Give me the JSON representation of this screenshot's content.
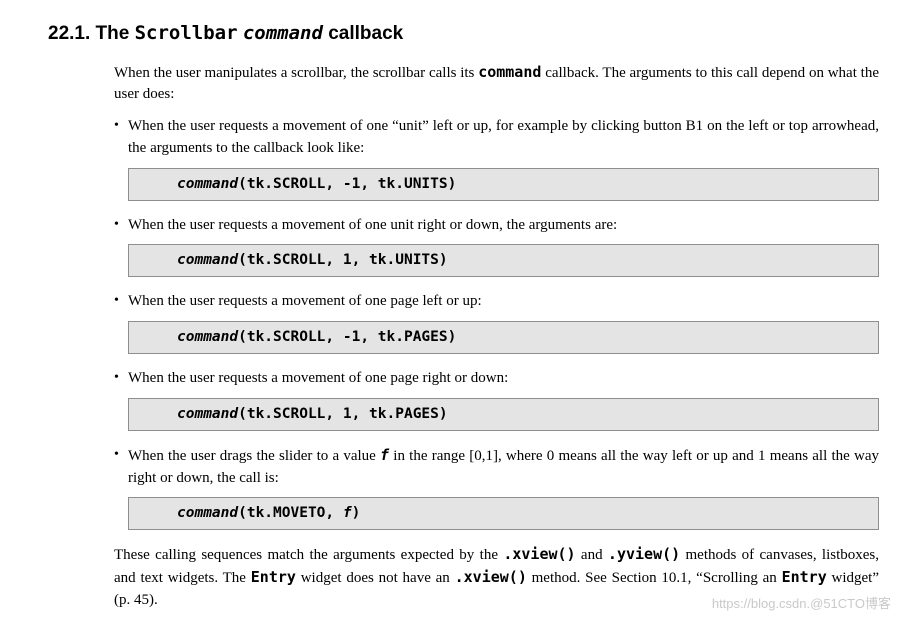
{
  "heading": {
    "number": "22.1.",
    "prefix": "The ",
    "code1": "Scrollbar",
    "space": " ",
    "code2": "command",
    "suffix": " callback"
  },
  "intro": {
    "t1": "When the user manipulates a scrollbar, the scrollbar calls its ",
    "c1": "command",
    "t2": " callback. The arguments to this call depend on what the user does:"
  },
  "items": [
    {
      "text": "When the user requests a movement of one “unit” left or up, for example by clicking button B1 on the left or top arrowhead, the arguments to the callback look like:",
      "code_i": "command",
      "code_r": "(tk.SCROLL, -1, tk.UNITS)"
    },
    {
      "text": "When the user requests a movement of one unit right or down, the arguments are:",
      "code_i": "command",
      "code_r": "(tk.SCROLL, 1, tk.UNITS)"
    },
    {
      "text": "When the user requests a movement of one page left or up:",
      "code_i": "command",
      "code_r": "(tk.SCROLL, -1, tk.PAGES)"
    },
    {
      "text": "When the user requests a movement of one page right or down:",
      "code_i": "command",
      "code_r": "(tk.SCROLL, 1, tk.PAGES)"
    },
    {
      "text_pre": "When the user drags the slider to a value ",
      "text_f": "f",
      "text_post": " in the range [0,1], where 0 means all the way left or up and 1 means all the way right or down, the call is:",
      "code_i": "command",
      "code_r1": "(tk.MOVETO, ",
      "code_if": "f",
      "code_r2": ")"
    }
  ],
  "closing": {
    "t1": "These calling sequences match the arguments expected by the ",
    "c1": ".xview()",
    "t2": " and ",
    "c2": ".yview()",
    "t3": " methods of canvases, listboxes, and text widgets. The ",
    "c3": "Entry",
    "t4": " widget does not have an ",
    "c4": ".xview()",
    "t5": " method. See Section 10.1, “Scrolling an ",
    "c5": "Entry",
    "t6": " widget” (p. 45)."
  },
  "watermark": {
    "t1": "https://blog.csdn.",
    "t2": "@51CTO博客"
  }
}
